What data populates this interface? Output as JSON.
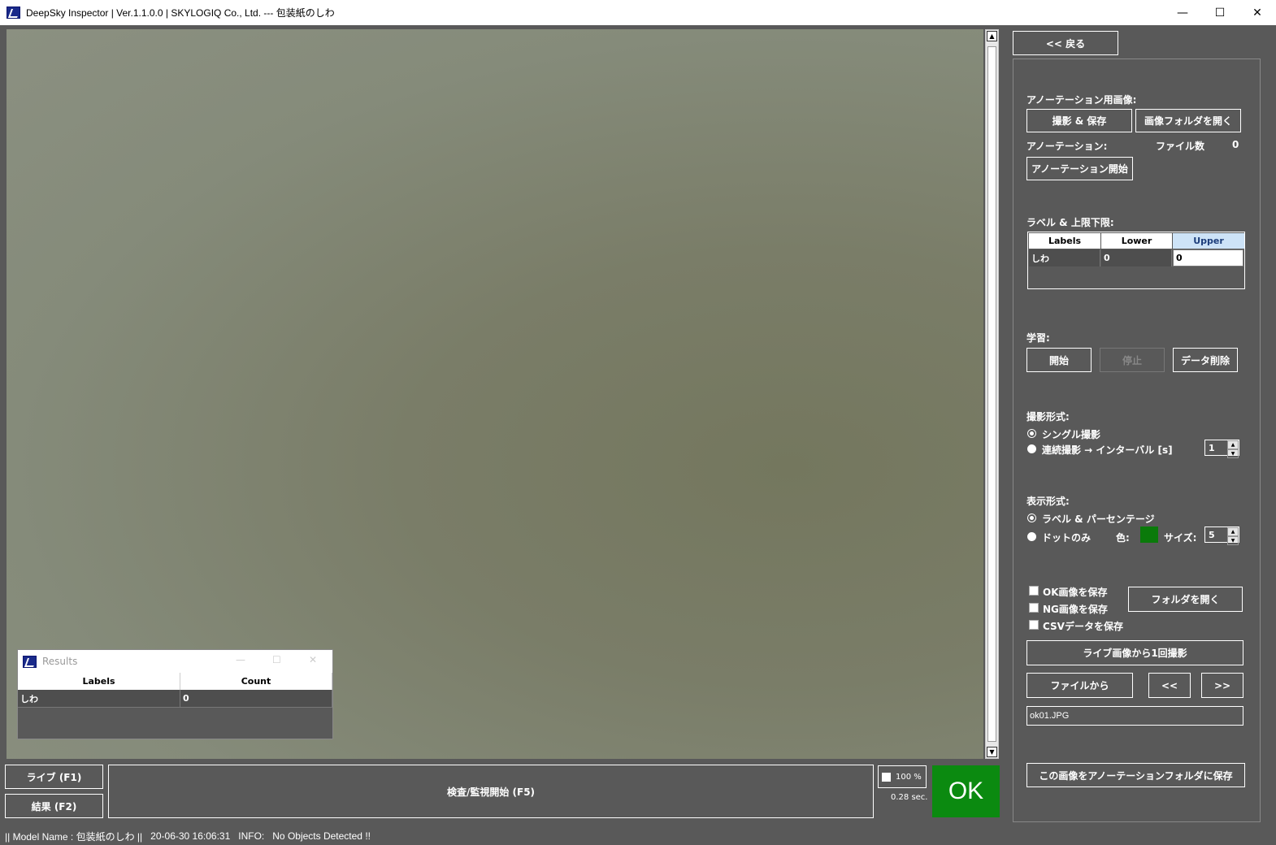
{
  "window": {
    "title": "DeepSky Inspector | Ver.1.1.0.0 | SKYLOGIQ Co., Ltd. --- 包装紙のしわ",
    "minimize": "—",
    "maximize": "☐",
    "close": "✕"
  },
  "results_window": {
    "title": "Results",
    "columns": [
      "Labels",
      "Count"
    ],
    "rows": [
      {
        "label": "しわ",
        "count": "0"
      }
    ]
  },
  "bottom": {
    "live_button": "ライブ (F1)",
    "result_button": "結果 (F2)",
    "inspect_button": "検査/監視開始 (F5)",
    "zoom": "100 %",
    "elapsed": "0.28 sec.",
    "verdict": "OK",
    "verdict_color": "#0b8a10"
  },
  "panel": {
    "back_button": "<< 戻る",
    "annotation_image_label": "アノーテーション用画像:",
    "capture_save_button": "撮影 & 保存",
    "open_image_folder_button": "画像フォルダを開く",
    "annotation_label": "アノーテーション:",
    "file_count_label": "ファイル数",
    "file_count_value": "0",
    "start_annotation_button": "アノーテーション開始",
    "label_limits_label": "ラベル & 上限下限:",
    "label_table": {
      "columns": [
        "Labels",
        "Lower",
        "Upper"
      ],
      "rows": [
        {
          "label": "しわ",
          "lower": "0",
          "upper": "0"
        }
      ]
    },
    "training_label": "学習:",
    "train_start_button": "開始",
    "train_stop_button": "停止",
    "delete_data_button": "データ削除",
    "capture_mode_label": "撮影形式:",
    "single_capture_label": "シングル撮影",
    "continuous_capture_label": "連続撮影 → インターバル [s]",
    "interval_value": "1",
    "display_mode_label": "表示形式:",
    "label_percent_label": "ラベル & パーセンテージ",
    "dots_only_label": "ドットのみ",
    "color_label": "色:",
    "dot_color": "#0a7a0a",
    "size_label": "サイズ:",
    "size_value": "5",
    "save_ok_label": "OK画像を保存",
    "save_ng_label": "NG画像を保存",
    "save_csv_label": "CSVデータを保存",
    "open_folder_button": "フォルダを開く",
    "capture_once_button": "ライブ画像から1回撮影",
    "from_file_button": "ファイルから",
    "prev_button": "<<",
    "next_button": ">>",
    "file_name": "ok01.JPG",
    "save_to_annotation_button": "この画像をアノーテーションフォルダに保存"
  },
  "status": {
    "model": "|| Model Name : 包装紙のしわ ||",
    "timestamp": "20-06-30 16:06:31",
    "info_label": "INFO:",
    "info_text": "No Objects Detected !!"
  }
}
